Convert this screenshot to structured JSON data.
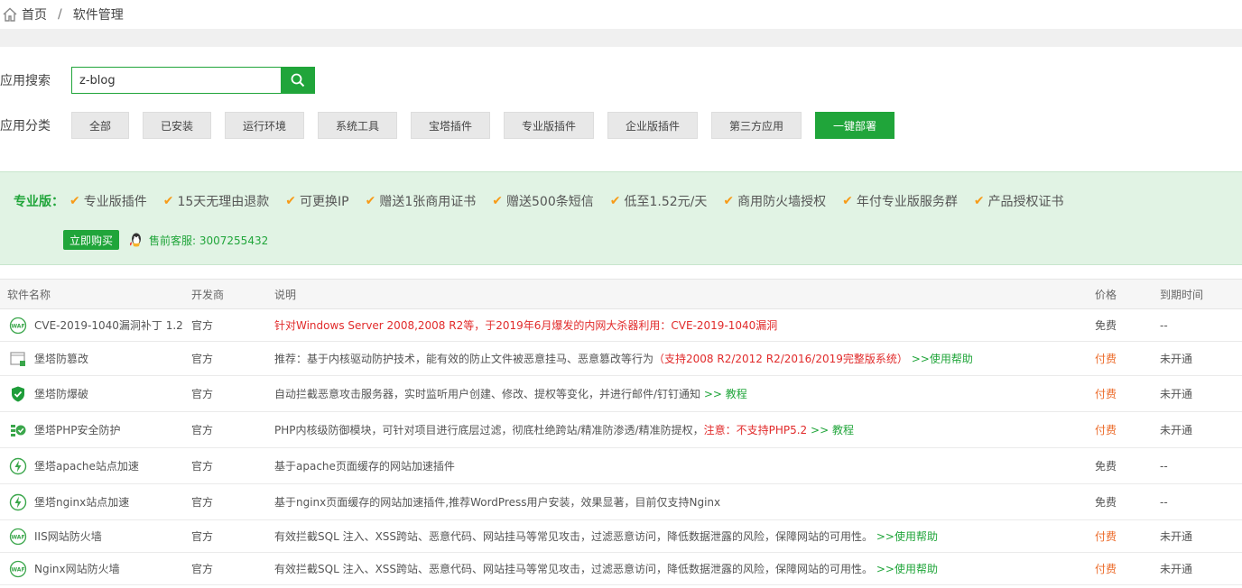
{
  "breadcrumb": {
    "home": "首页",
    "separator": "/",
    "current": "软件管理"
  },
  "search": {
    "label": "应用搜索",
    "value": "z-blog"
  },
  "categories": {
    "label": "应用分类",
    "items": [
      "全部",
      "已安装",
      "运行环境",
      "系统工具",
      "宝塔插件",
      "专业版插件",
      "企业版插件",
      "第三方应用",
      "一键部署"
    ],
    "active": "一键部署"
  },
  "promo": {
    "title": "专业版：",
    "features": [
      "专业版插件",
      "15天无理由退款",
      "可更换IP",
      "赠送1张商用证书",
      "赠送500条短信",
      "低至1.52元/天",
      "商用防火墙授权",
      "年付专业版服务群",
      "产品授权证书"
    ],
    "buy_label": "立即购买",
    "contact": "售前客服: 3007255432"
  },
  "table": {
    "headers": [
      "软件名称",
      "开发商",
      "说明",
      "价格",
      "到期时间"
    ],
    "rows": [
      {
        "icon": "waf-icon",
        "name": "CVE-2019-1040漏洞补丁 1.2",
        "vendor": "官方",
        "desc": "",
        "desc_red": "针对Windows Server 2008,2008 R2等，于2019年6月爆发的内网大杀器利用：CVE-2019-1040漏洞",
        "desc_link": "",
        "price": "免费",
        "expire": "--"
      },
      {
        "icon": "tamper-icon",
        "name": "堡塔防篡改",
        "vendor": "官方",
        "desc": "推荐：基于内核驱动防护技术，能有效的防止文件被恶意挂马、恶意篡改等行为",
        "desc_red": "（支持2008 R2/2012 R2/2016/2019完整版系统）",
        "desc_link": ">>使用帮助",
        "price": "付费",
        "expire": "未开通"
      },
      {
        "icon": "shield-icon",
        "name": "堡塔防爆破",
        "vendor": "官方",
        "desc": "自动拦截恶意攻击服务器，实时监听用户创建、修改、提权等变化，并进行邮件/钉钉通知",
        "desc_red": "",
        "desc_link": ">> 教程",
        "price": "付费",
        "expire": "未开通"
      },
      {
        "icon": "php-guard-icon",
        "name": "堡塔PHP安全防护",
        "vendor": "官方",
        "desc": "PHP内核级防御模块，可针对项目进行底层过滤，彻底杜绝跨站/精准防渗透/精准防提权，",
        "desc_red": "注意：不支持PHP5.2",
        "desc_link": ">> 教程",
        "price": "付费",
        "expire": "未开通"
      },
      {
        "icon": "bolt-icon",
        "name": "堡塔apache站点加速",
        "vendor": "官方",
        "desc": "基于apache页面缓存的网站加速插件",
        "desc_red": "",
        "desc_link": "",
        "price": "免费",
        "expire": "--"
      },
      {
        "icon": "bolt-icon",
        "name": "堡塔nginx站点加速",
        "vendor": "官方",
        "desc": "基于nginx页面缓存的网站加速插件,推荐WordPress用户安装，效果显著，目前仅支持Nginx",
        "desc_red": "",
        "desc_link": "",
        "price": "免费",
        "expire": "--"
      },
      {
        "icon": "waf-icon",
        "name": "IIS网站防火墙",
        "vendor": "官方",
        "desc": "有效拦截SQL 注入、XSS跨站、恶意代码、网站挂马等常见攻击，过滤恶意访问，降低数据泄露的风险，保障网站的可用性。",
        "desc_red": "",
        "desc_link": ">>使用帮助",
        "price": "付费",
        "expire": "未开通"
      },
      {
        "icon": "waf-icon",
        "name": "Nginx网站防火墙",
        "vendor": "官方",
        "desc": "有效拦截SQL 注入、XSS跨站、恶意代码、网站挂马等常见攻击，过滤恶意访问，降低数据泄露的风险，保障网站的可用性。",
        "desc_red": "",
        "desc_link": ">>使用帮助",
        "price": "付费",
        "expire": "未开通"
      }
    ]
  },
  "colors": {
    "accent": "#20a53a",
    "paid": "#ec6b2a",
    "warning": "#e12b2b",
    "check": "#f79b18"
  }
}
